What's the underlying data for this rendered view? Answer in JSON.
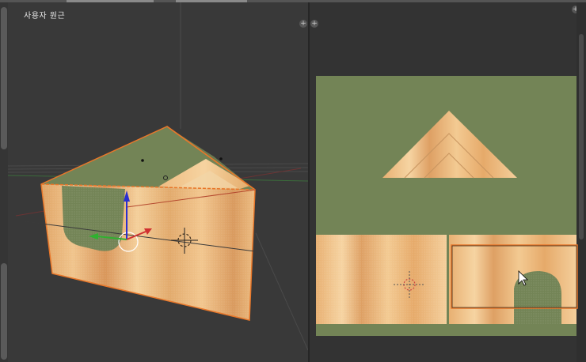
{
  "viewport3d": {
    "title": "사용자 원근",
    "corner_icon": "plus-icon"
  },
  "uv_editor": {
    "corner_icon": "plus-icon"
  },
  "colors": {
    "background_dark": "#393939",
    "uv_background": "#333333",
    "face_green": "#738456",
    "selection_orange": "#e8772a",
    "axis_x": "#d03030",
    "axis_y": "#30b030",
    "axis_z": "#2a30d0"
  },
  "icons": [
    "plus-icon",
    "mouse-cursor-icon",
    "3d-cursor-icon",
    "transform-gizmo-icon"
  ]
}
